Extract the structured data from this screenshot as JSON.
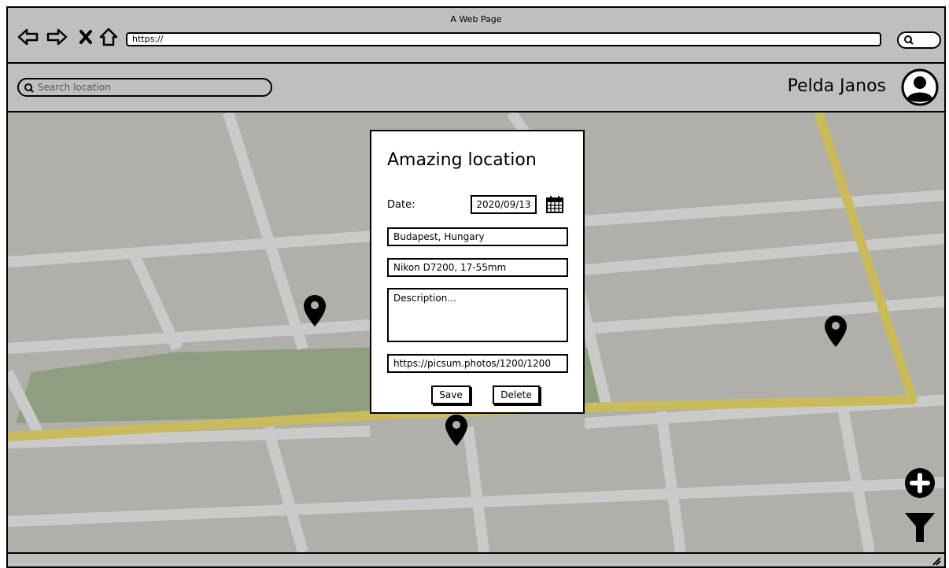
{
  "browser": {
    "page_title": "A Web Page",
    "url": "https://"
  },
  "header": {
    "search_placeholder": "Search location",
    "user_name": "Pelda Janos"
  },
  "card": {
    "title": "Amazing location",
    "date_label": "Date:",
    "date_value": "2020/09/13",
    "location_value": "Budapest, Hungary",
    "camera_value": "Nikon D7200, 17-55mm",
    "description_placeholder": "Description...",
    "image_url_value": "https://picsum.photos/1200/1200",
    "save_label": "Save",
    "delete_label": "Delete"
  },
  "map": {
    "colors": {
      "background": "#b0afaa",
      "street": "#cacaca",
      "main_road": "#c9bb5b",
      "park": "#8f9e80"
    },
    "markers": [
      "map-pin-icon",
      "map-pin-icon",
      "map-pin-icon"
    ]
  },
  "icons": {
    "back": "arrow-left-icon",
    "forward": "arrow-right-icon",
    "stop": "close-icon",
    "home": "home-icon",
    "calendar": "calendar-icon",
    "add": "plus-circle-icon",
    "filter": "filter-icon",
    "avatar": "user-avatar-icon"
  }
}
